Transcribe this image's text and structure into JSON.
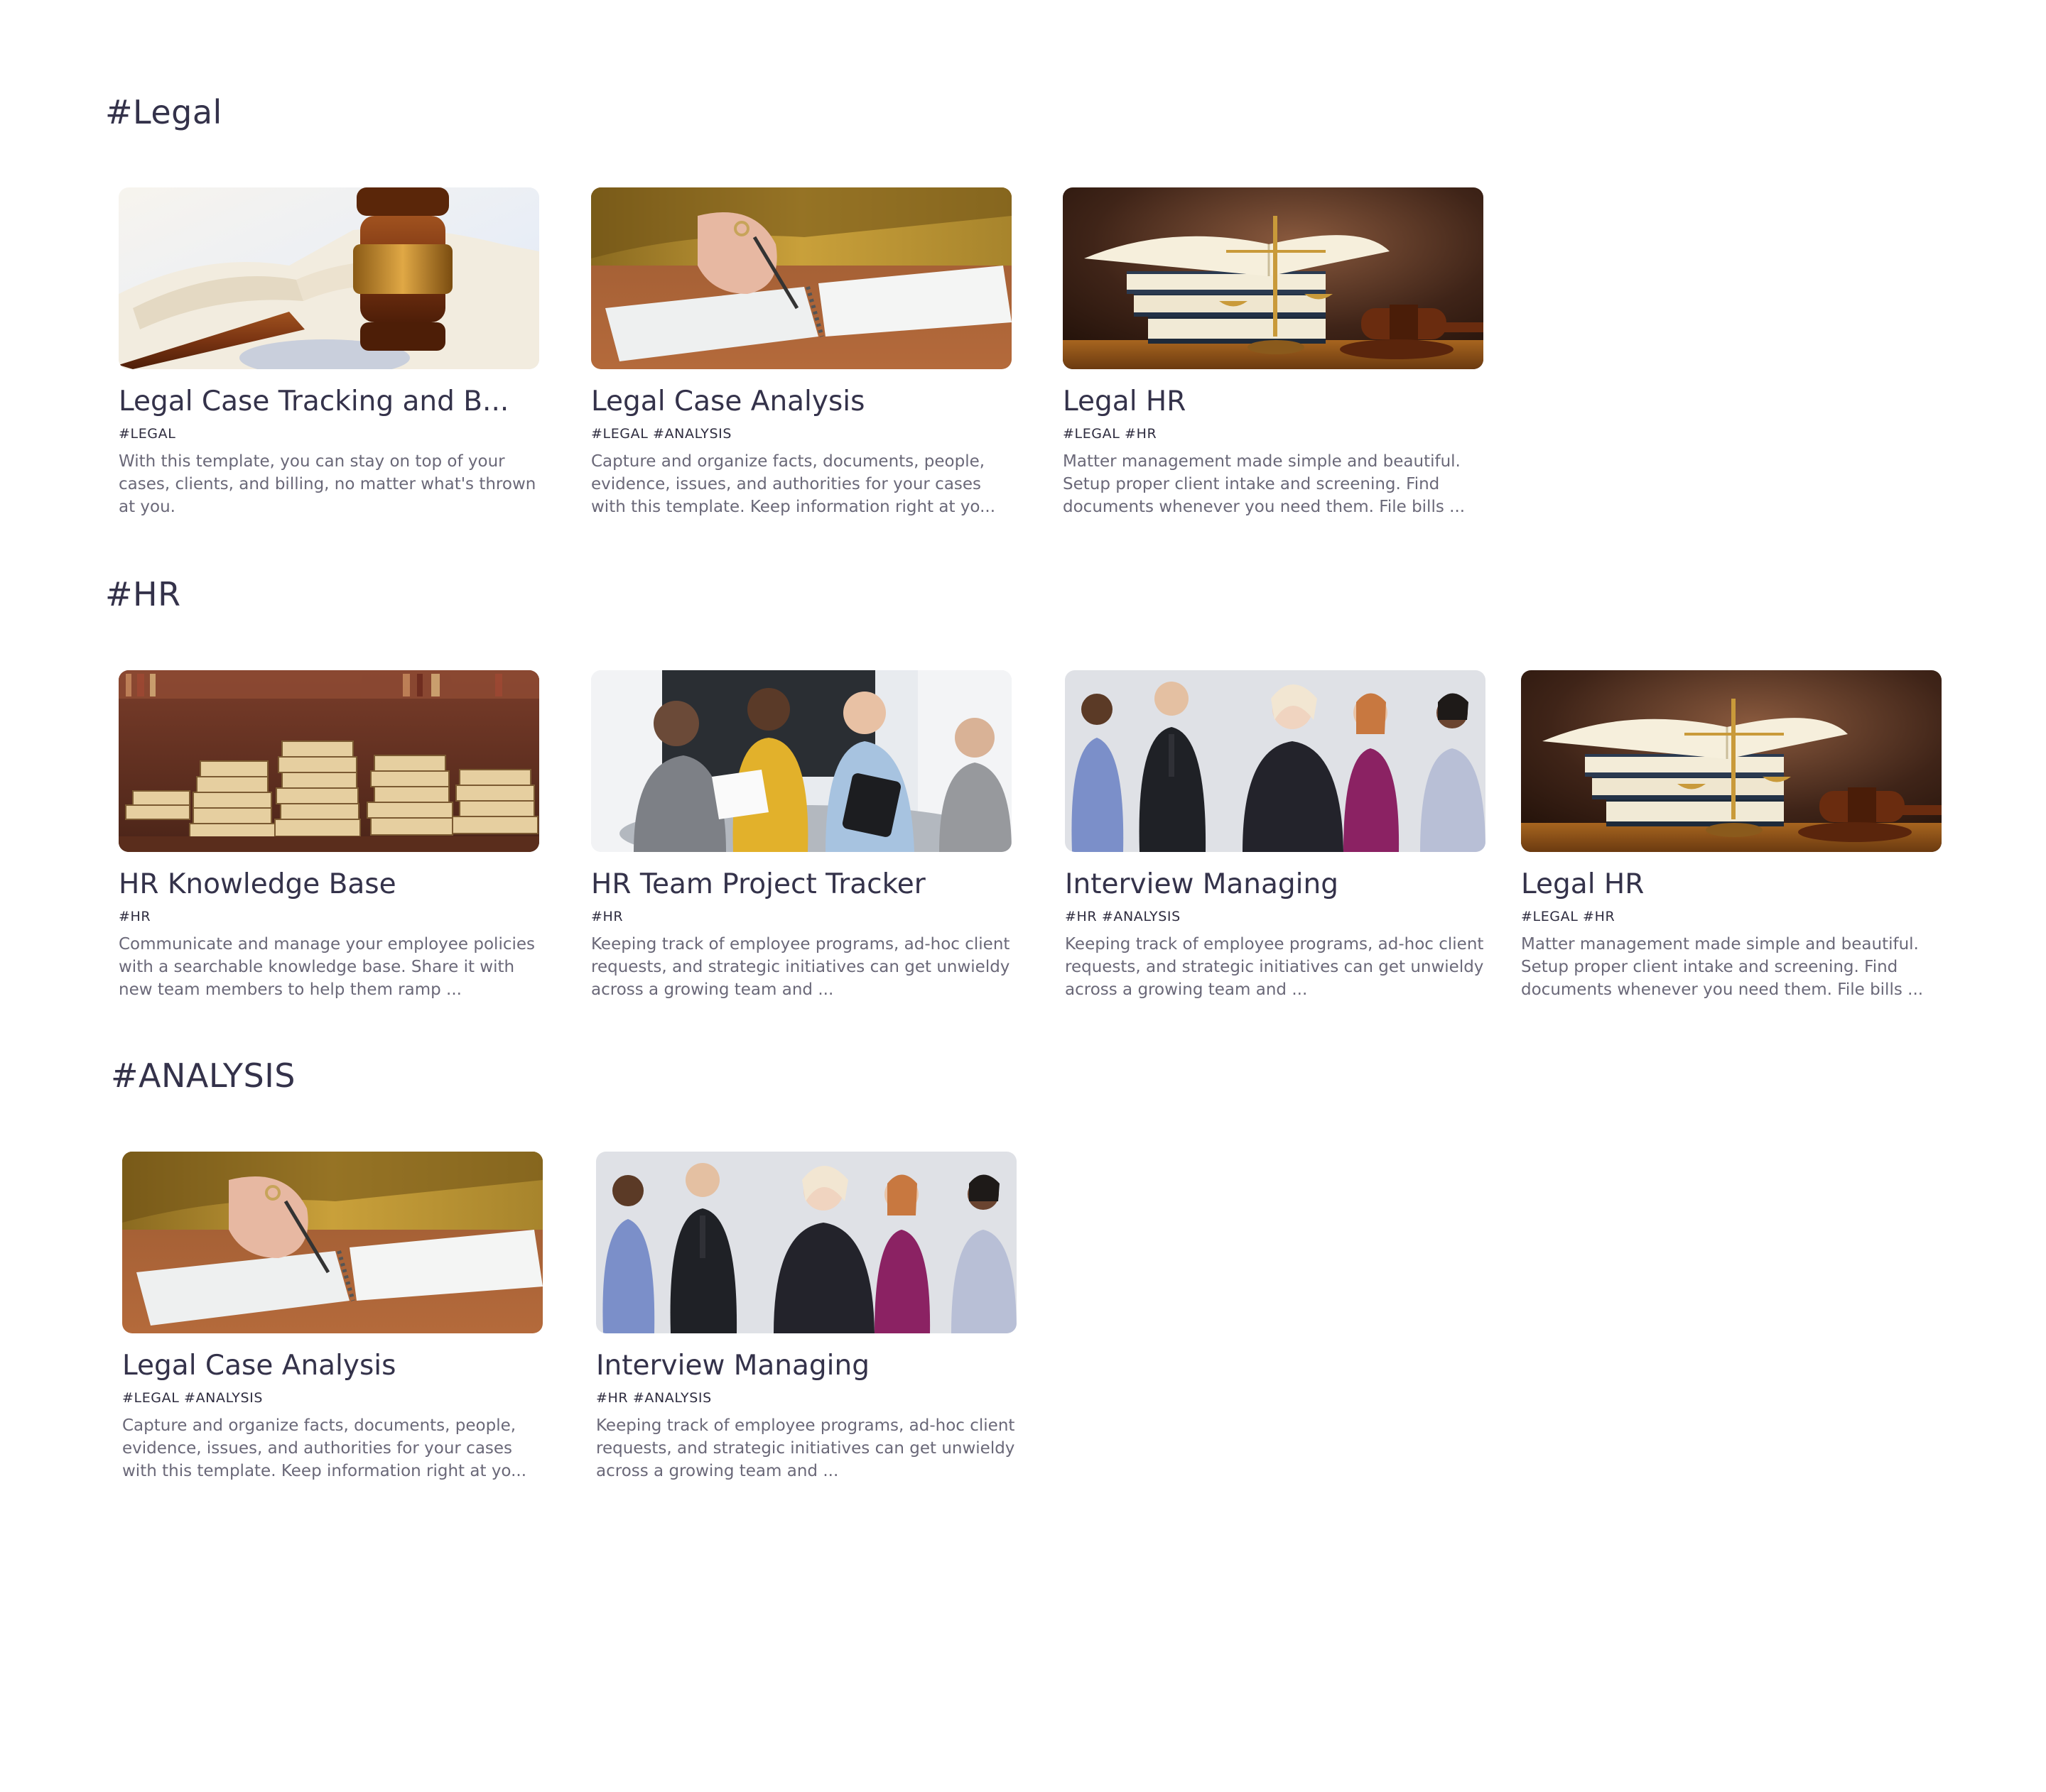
{
  "sections": [
    {
      "title": "#Legal",
      "cards": [
        {
          "title": "Legal Case Tracking and B...",
          "tags": "#LEGAL",
          "description": "With this template, you can stay on top of your cases, clients, and billing, no matter what's thrown at you.",
          "image": "gavel-photo"
        },
        {
          "title": "Legal Case Analysis",
          "tags": "#LEGAL #ANALYSIS",
          "description": "Capture and organize facts, documents, people, evidence, issues, and authorities for your cases with this template. Keep information right at yo...",
          "image": "writing-notebook-photo"
        },
        {
          "title": "Legal HR",
          "tags": "#LEGAL #HR",
          "description": "Matter management made simple and beautiful. Setup proper client intake and screening. Find documents whenever you need them. File bills ...",
          "image": "law-books-scales-photo"
        }
      ]
    },
    {
      "title": "#HR",
      "cards": [
        {
          "title": "HR Knowledge Base",
          "tags": "#HR",
          "description": "Communicate and manage your employee policies with a searchable knowledge base. Share it with new team members to help them ramp ...",
          "image": "book-stacks-photo"
        },
        {
          "title": "HR Team Project Tracker",
          "tags": "#HR",
          "description": "Keeping track of employee programs, ad-hoc client requests, and strategic initiatives can get unwieldy across a growing team and ...",
          "image": "team-meeting-photo"
        },
        {
          "title": "Interview Managing",
          "tags": "#HR #ANALYSIS",
          "description": "Keeping track of employee programs, ad-hoc client requests, and strategic initiatives can get unwieldy across a growing team and ...",
          "image": "business-people-photo"
        },
        {
          "title": "Legal HR",
          "tags": "#LEGAL #HR",
          "description": "Matter management made simple and beautiful. Setup proper client intake and screening. Find documents whenever you need them. File bills ...",
          "image": "law-books-scales-photo"
        }
      ]
    },
    {
      "title": "#ANALYSIS",
      "cards": [
        {
          "title": "Legal Case Analysis",
          "tags": "#LEGAL #ANALYSIS",
          "description": "Capture and organize facts, documents, people, evidence, issues, and authorities for your cases with this template. Keep information right at yo...",
          "image": "writing-notebook-photo"
        },
        {
          "title": "Interview Managing",
          "tags": "#HR #ANALYSIS",
          "description": "Keeping track of employee programs, ad-hoc client requests, and strategic initiatives can get unwieldy across a growing team and ...",
          "image": "business-people-photo"
        }
      ]
    }
  ]
}
